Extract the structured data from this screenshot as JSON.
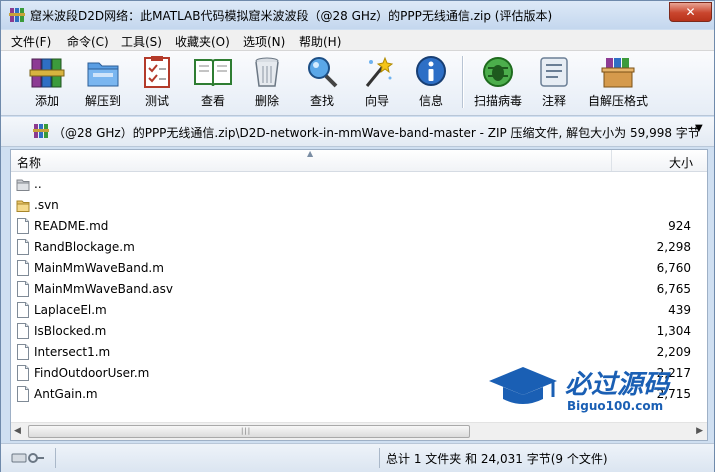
{
  "window": {
    "title": "窟米波段D2D网络：此MATLAB代码模拟窟米波波段（@28 GHz）的PPP无线通信.zip (评估版本)",
    "close_label": "✕"
  },
  "menu": [
    "文件(F)",
    "命令(C)",
    "工具(S)",
    "收藏夹(O)",
    "选项(N)",
    "帮助(H)"
  ],
  "toolbar": [
    {
      "label": "添加",
      "icon": "books-add-icon"
    },
    {
      "label": "解压到",
      "icon": "folder-extract-icon"
    },
    {
      "label": "测试",
      "icon": "checklist-icon"
    },
    {
      "label": "查看",
      "icon": "open-book-icon"
    },
    {
      "label": "删除",
      "icon": "trash-icon"
    },
    {
      "label": "查找",
      "icon": "magnifier-icon"
    },
    {
      "label": "向导",
      "icon": "wizard-wand-icon"
    },
    {
      "label": "信息",
      "icon": "info-icon"
    },
    {
      "label": "扫描病毒",
      "icon": "virus-scan-icon"
    },
    {
      "label": "注释",
      "icon": "comment-icon"
    },
    {
      "label": "自解压格式",
      "icon": "sfx-box-icon"
    }
  ],
  "address": {
    "path": "（@28 GHz）的PPP无线通信.zip\\D2D-network-in-mmWave-band-master - ZIP 压缩文件, 解包大小为 59,998 字节",
    "dropdown": "▼"
  },
  "columns": {
    "name": "名称",
    "size": "大小"
  },
  "files": [
    {
      "name": "..",
      "size": "",
      "type": "folder-up"
    },
    {
      "name": ".svn",
      "size": "",
      "type": "folder"
    },
    {
      "name": "README.md",
      "size": "924",
      "type": "file"
    },
    {
      "name": "RandBlockage.m",
      "size": "2,298",
      "type": "file"
    },
    {
      "name": "MainMmWaveBand.m",
      "size": "6,760",
      "type": "file"
    },
    {
      "name": "MainMmWaveBand.asv",
      "size": "6,765",
      "type": "file"
    },
    {
      "name": "LaplaceEl.m",
      "size": "439",
      "type": "file"
    },
    {
      "name": "IsBlocked.m",
      "size": "1,304",
      "type": "file"
    },
    {
      "name": "Intersect1.m",
      "size": "2,209",
      "type": "file"
    },
    {
      "name": "FindOutdoorUser.m",
      "size": "2,217",
      "type": "file"
    },
    {
      "name": "AntGain.m",
      "size": "2,715",
      "type": "file"
    }
  ],
  "status": {
    "summary": "总计 1 文件夹 和 24,031 字节(9 个文件)"
  },
  "watermark": {
    "title": "必过源码",
    "url": "Biguo100.com"
  },
  "colors": {
    "accent": "#1a5fb4",
    "title_bg": "#c4d7ee",
    "close": "#c9452d"
  }
}
